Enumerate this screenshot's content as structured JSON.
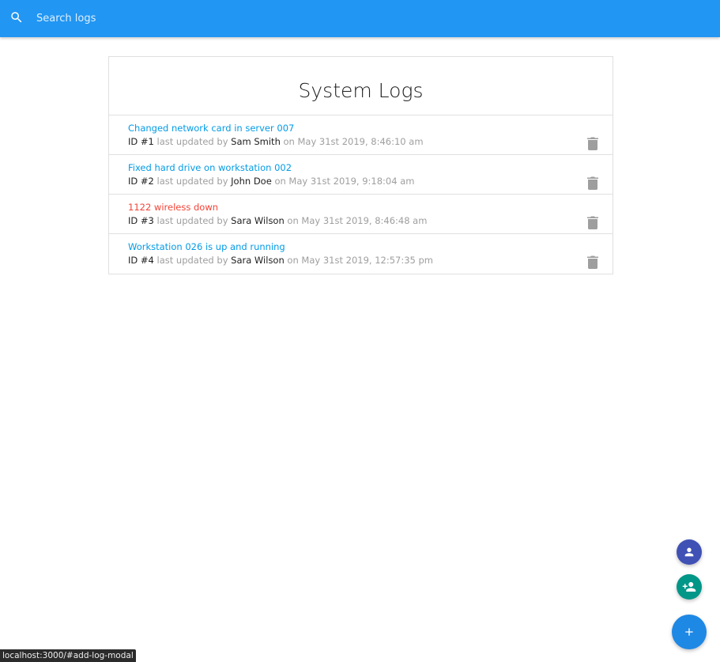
{
  "search": {
    "placeholder": "Search logs",
    "value": "",
    "icon": "search-icon"
  },
  "header": {
    "title": "System Logs"
  },
  "logs": [
    {
      "message": "Changed network card in server 007",
      "attention": false,
      "id_label": "ID #1",
      "last_updated_by_label": "last updated by",
      "tech": "Sam Smith",
      "date_label": "on May 31st 2019, 8:46:10 am"
    },
    {
      "message": "Fixed hard drive on workstation 002",
      "attention": false,
      "id_label": "ID #2",
      "last_updated_by_label": "last updated by",
      "tech": "John Doe",
      "date_label": "on May 31st 2019, 9:18:04 am"
    },
    {
      "message": "1122 wireless down",
      "attention": true,
      "id_label": "ID #3",
      "last_updated_by_label": "last updated by",
      "tech": "Sara Wilson",
      "date_label": "on May 31st 2019, 8:46:48 am"
    },
    {
      "message": "Workstation 026 is up and running",
      "attention": false,
      "id_label": "ID #4",
      "last_updated_by_label": "last updated by",
      "tech": "Sara Wilson",
      "date_label": "on May 31st 2019, 12:57:35 pm"
    }
  ],
  "fabs": {
    "users_icon": "person-icon",
    "add_tech_icon": "person-add-icon",
    "add_log_icon": "plus-icon"
  },
  "status_bar": {
    "url": "localhost:3000/#add-log-modal"
  },
  "colors": {
    "primary": "#2196f3",
    "link": "#039be5",
    "attention": "#f44336",
    "fab_users": "#3f51b5",
    "fab_add_tech": "#009688",
    "fab_add_log": "#1e88e5",
    "muted_text": "#9e9e9e"
  }
}
